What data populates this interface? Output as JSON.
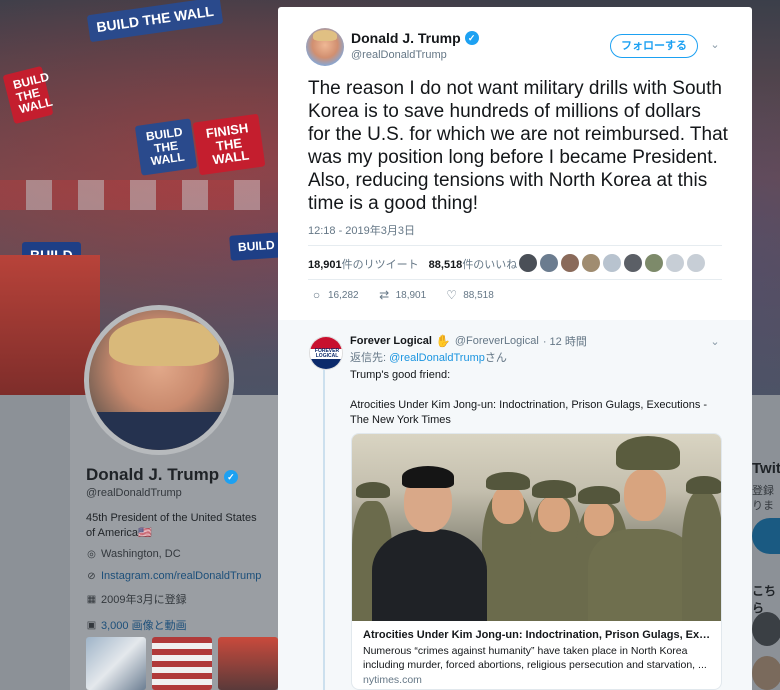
{
  "background_profile": {
    "banner_signs": [
      "BUILD THE WALL",
      "FINISH THE WALL",
      "BUILD THE WALL",
      "BUILD",
      "BUILD",
      "BUILD THE WALL"
    ],
    "name": "Donald J. Trump",
    "handle": "@realDonaldTrump",
    "bio": "45th President of the United States of America🇺🇸",
    "location": "Washington, DC",
    "link": "Instagram.com/realDonaldTrump",
    "joined": "2009年3月に登録",
    "media": "3,000 画像と動画",
    "right_title": "Twit",
    "right_line1": "登録",
    "right_line2": "りま",
    "right_sub": "こちら"
  },
  "tweet": {
    "author_name": "Donald J. Trump",
    "author_handle": "@realDonaldTrump",
    "follow_label": "フォローする",
    "text": "The reason I do not want military drills with South Korea is to save hundreds of millions of dollars for the U.S. for which we are not reimbursed. That was my position long before I became President. Also, reducing tensions with North Korea at this time is a good thing!",
    "timestamp": "12:18 - 2019年3月3日",
    "retweet_count": "18,901",
    "retweet_label": "件のリツイート",
    "like_count": "88,518",
    "like_label": "件のいいね",
    "actions": {
      "replies": "16,282",
      "retweets": "18,901",
      "likes": "88,518"
    }
  },
  "reply": {
    "author_name": "Forever Logical",
    "hand_emoji": "✋",
    "author_handle": "@ForeverLogical",
    "time": "· 12 時間",
    "reply_to_prefix": "返信先:",
    "reply_to_mention": "@realDonaldTrump",
    "reply_to_suffix": "さん",
    "avatar_text": "FOREVER LOGICAL",
    "body_line1": "Trump's good friend:",
    "body_line2": "Atrocities Under Kim Jong-un: Indoctrination, Prison Gulags, Executions - The New York Times",
    "card": {
      "title": "Atrocities Under Kim Jong-un: Indoctrination, Prison Gulags, Executions - The New York Times",
      "description": "Numerous “crimes against humanity” have taken place in North Korea including murder, forced abortions, religious persecution and starvation, ...",
      "domain": "nytimes.com"
    }
  },
  "colors": {
    "accent": "#1da1f2",
    "mention": "#1b95e0",
    "muted": "#657786",
    "text": "#14171a"
  },
  "icons": [
    "verified-badge-icon",
    "chevron-down-icon",
    "reply-icon",
    "retweet-icon",
    "like-icon",
    "location-icon",
    "link-icon",
    "calendar-icon",
    "media-icon"
  ]
}
